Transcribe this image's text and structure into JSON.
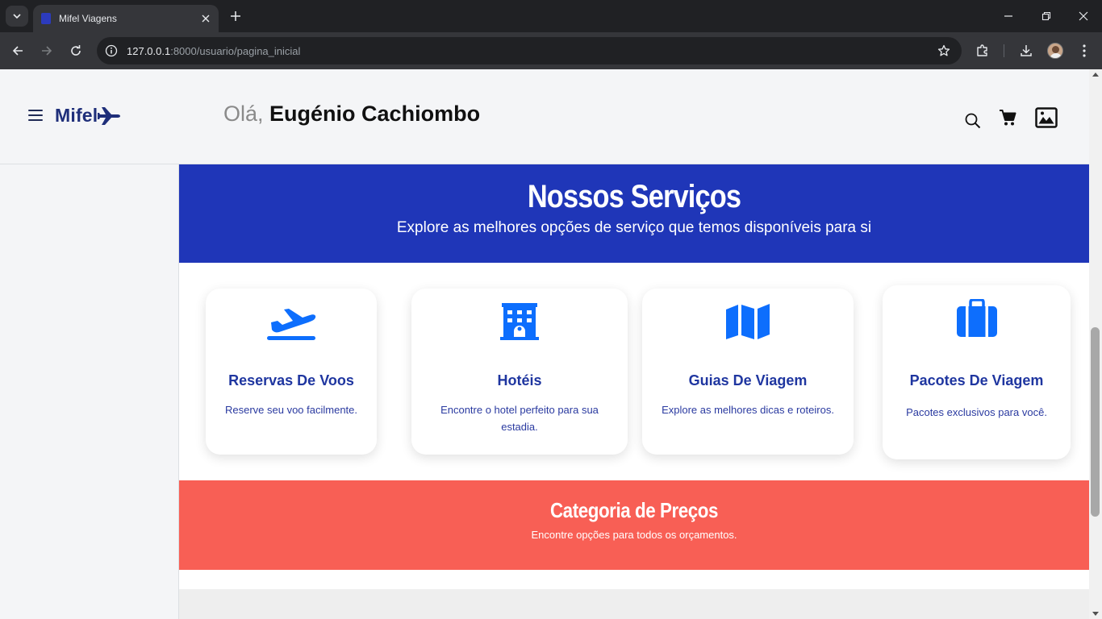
{
  "browser": {
    "tab_title": "Mifel Viagens",
    "url_host": "127.0.0.1",
    "url_rest": ":8000/usuario/pagina_inicial"
  },
  "header": {
    "logo_text": "Mifel",
    "greeting_prefix": "Olá,",
    "user_name": "Eugénio Cachiombo"
  },
  "services": {
    "title": "Nossos Serviços",
    "subtitle": "Explore as melhores opções de serviço que temos disponíveis para si",
    "cards": [
      {
        "icon": "plane-takeoff-icon",
        "title": "Reservas De Voos",
        "description": "Reserve seu voo facilmente."
      },
      {
        "icon": "hotel-icon",
        "title": "Hotéis",
        "description": "Encontre o hotel perfeito para sua estadia."
      },
      {
        "icon": "map-icon",
        "title": "Guias De Viagem",
        "description": "Explore as melhores dicas e roteiros."
      },
      {
        "icon": "suitcase-icon",
        "title": "Pacotes De Viagem",
        "description": "Pacotes exclusivos para você."
      }
    ]
  },
  "pricing": {
    "title": "Categoria de Preços",
    "subtitle": "Encontre opções para todos os orçamentos."
  },
  "colors": {
    "primary_blue": "#1f36b8",
    "icon_blue": "#0d6efd",
    "coral": "#f85f55",
    "logo_navy": "#1f2f7a"
  }
}
